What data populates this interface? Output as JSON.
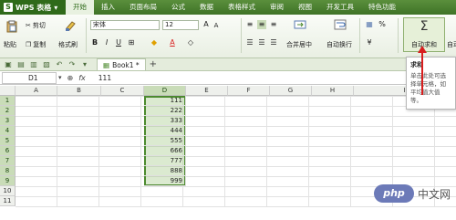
{
  "menubar": {
    "app_name": "WPS 表格",
    "app_logo": "S",
    "items": [
      "开始",
      "插入",
      "页面布局",
      "公式",
      "数据",
      "表格样式",
      "审阅",
      "视图",
      "开发工具",
      "特色功能"
    ]
  },
  "ribbon": {
    "cut": "剪切",
    "paste": "粘贴",
    "copy": "复制",
    "format_painter": "格式刷",
    "font": "宋体",
    "size": "12",
    "merge": "合并居中",
    "wrap": "自动换行",
    "percent": "%",
    "autosum": "自动求和",
    "autosum_right": "自动"
  },
  "tabs": {
    "book": "Book1 *",
    "plus": "+"
  },
  "formula_bar": {
    "name_box": "D1",
    "fx": "fx",
    "value": "111"
  },
  "grid": {
    "columns": [
      "A",
      "B",
      "C",
      "D",
      "E",
      "F",
      "G",
      "H",
      "I"
    ],
    "rows": [
      "1",
      "2",
      "3",
      "4",
      "5",
      "6",
      "7",
      "8",
      "9",
      "10",
      "11"
    ],
    "d_values": [
      "111",
      "222",
      "333",
      "444",
      "555",
      "666",
      "777",
      "888",
      "999"
    ]
  },
  "tooltip": {
    "title": "求和",
    "body": "单击此处可选择单元格，如平均值大值等。"
  },
  "watermark": {
    "logo": "php",
    "text": "中文网"
  },
  "colors": {
    "accent": "#4c8a2f",
    "arrow": "#d81e1e"
  }
}
